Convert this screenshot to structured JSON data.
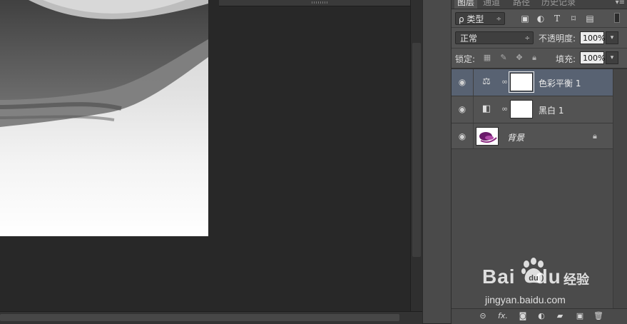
{
  "panel": {
    "tabs": [
      "图层",
      "通道",
      "路径",
      "历史记录"
    ],
    "menu_glyph": "▾≡",
    "filter": {
      "label": "ρ 类型",
      "arrow": "÷"
    },
    "filter_icons": [
      "image-filter-icon",
      "adjustment-filter-icon",
      "type-filter-icon",
      "shape-filter-icon",
      "smart-object-filter-icon"
    ],
    "blend_mode": "正常",
    "opacity_label": "不透明度:",
    "opacity_value": "100%",
    "lock_label": "锁定:",
    "fill_label": "填充:",
    "fill_value": "100%"
  },
  "layers": [
    {
      "name": "色彩平衡 1",
      "type": "adjustment",
      "icon": "balance-scale-icon",
      "selected": true,
      "visible": true
    },
    {
      "name": "黑白 1",
      "type": "adjustment",
      "icon": "black-white-icon",
      "selected": false,
      "visible": true
    },
    {
      "name": "背景",
      "type": "background",
      "locked": true,
      "visible": true
    }
  ],
  "footer_icons": [
    "link-layers-icon",
    "fx-icon",
    "add-mask-icon",
    "new-adjustment-icon",
    "new-group-icon",
    "new-layer-icon",
    "delete-layer-icon"
  ],
  "footer": {
    "fx": "fx."
  },
  "watermark": {
    "brand": "Bai",
    "brand2": "du",
    "cn": "经验",
    "url": "jingyan.baidu.com"
  },
  "colors": {
    "selected_layer": "#586272",
    "panel_bg": "#535353",
    "canvas_bg": "#282828"
  }
}
